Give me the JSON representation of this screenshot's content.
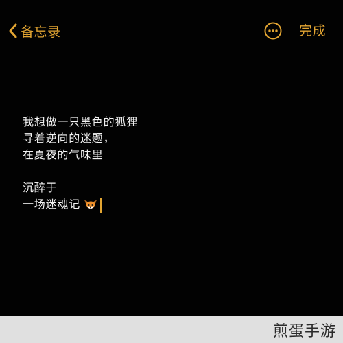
{
  "nav": {
    "back_label": "备忘录",
    "back_icon": "chevron-left-icon",
    "more_icon": "ellipsis-circle-icon",
    "done_label": "完成"
  },
  "note": {
    "lines": [
      "我想做一只黑色的狐狸",
      "寻着逆向的迷题，",
      "在夏夜的气味里",
      "",
      "沉醉于",
      "一场迷魂记"
    ],
    "trailing_emoji": "fox-face-emoji",
    "cursor_visible": true
  },
  "watermark": {
    "text": "煎蛋手游"
  },
  "colors": {
    "background": "#020202",
    "accent": "#e3a532",
    "text": "#f2f2f2",
    "watermark_bar": "#e0e0e0"
  }
}
